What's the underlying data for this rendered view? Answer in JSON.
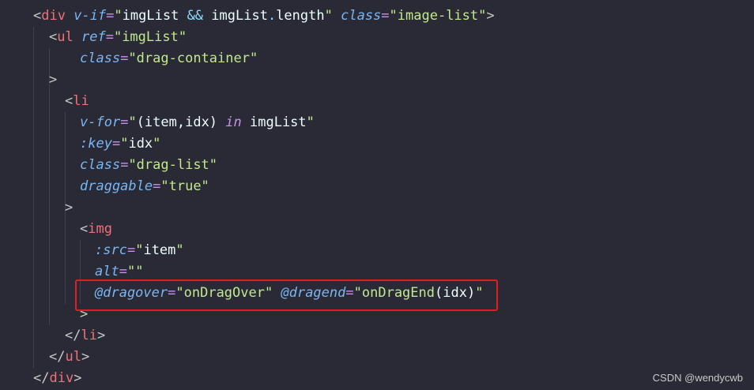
{
  "code_lines": [
    {
      "indent": 0,
      "tokens": [
        {
          "t": "<",
          "c": "punct"
        },
        {
          "t": "div",
          "c": "tag"
        },
        {
          "t": " ",
          "c": "plain"
        },
        {
          "t": "v-if",
          "c": "attr"
        },
        {
          "t": "=",
          "c": "eq"
        },
        {
          "t": "\"",
          "c": "str"
        },
        {
          "t": "imgList ",
          "c": "plain"
        },
        {
          "t": "&&",
          "c": "op"
        },
        {
          "t": " imgList",
          "c": "plain"
        },
        {
          "t": ".",
          "c": "op"
        },
        {
          "t": "length",
          "c": "plain"
        },
        {
          "t": "\"",
          "c": "str"
        },
        {
          "t": " ",
          "c": "plain"
        },
        {
          "t": "class",
          "c": "attr"
        },
        {
          "t": "=",
          "c": "eq"
        },
        {
          "t": "\"image-list\"",
          "c": "str"
        },
        {
          "t": ">",
          "c": "punct"
        }
      ]
    },
    {
      "indent": 1,
      "tokens": [
        {
          "t": "<",
          "c": "punct"
        },
        {
          "t": "ul",
          "c": "tag"
        },
        {
          "t": " ",
          "c": "plain"
        },
        {
          "t": "ref",
          "c": "attr"
        },
        {
          "t": "=",
          "c": "eq"
        },
        {
          "t": "\"imgList\"",
          "c": "str"
        }
      ]
    },
    {
      "indent": 3,
      "tokens": [
        {
          "t": "class",
          "c": "attr"
        },
        {
          "t": "=",
          "c": "eq"
        },
        {
          "t": "\"drag-container\"",
          "c": "str"
        }
      ]
    },
    {
      "indent": 1,
      "tokens": [
        {
          "t": ">",
          "c": "punct"
        }
      ]
    },
    {
      "indent": 2,
      "tokens": [
        {
          "t": "<",
          "c": "punct"
        },
        {
          "t": "li",
          "c": "tag"
        }
      ]
    },
    {
      "indent": 3,
      "tokens": [
        {
          "t": "v-for",
          "c": "attr"
        },
        {
          "t": "=",
          "c": "eq"
        },
        {
          "t": "\"",
          "c": "str"
        },
        {
          "t": "(item,idx) ",
          "c": "plain"
        },
        {
          "t": "in",
          "c": "kw"
        },
        {
          "t": " imgList",
          "c": "plain"
        },
        {
          "t": "\"",
          "c": "str"
        }
      ]
    },
    {
      "indent": 3,
      "tokens": [
        {
          "t": ":key",
          "c": "attr"
        },
        {
          "t": "=",
          "c": "eq"
        },
        {
          "t": "\"",
          "c": "str"
        },
        {
          "t": "idx",
          "c": "plain"
        },
        {
          "t": "\"",
          "c": "str"
        }
      ]
    },
    {
      "indent": 3,
      "tokens": [
        {
          "t": "class",
          "c": "attr"
        },
        {
          "t": "=",
          "c": "eq"
        },
        {
          "t": "\"drag-list\"",
          "c": "str"
        }
      ]
    },
    {
      "indent": 3,
      "tokens": [
        {
          "t": "draggable",
          "c": "attr"
        },
        {
          "t": "=",
          "c": "eq"
        },
        {
          "t": "\"true\"",
          "c": "str"
        }
      ]
    },
    {
      "indent": 2,
      "tokens": [
        {
          "t": ">",
          "c": "punct"
        }
      ]
    },
    {
      "indent": 3,
      "tokens": [
        {
          "t": "<",
          "c": "punct"
        },
        {
          "t": "img",
          "c": "tag"
        }
      ]
    },
    {
      "indent": 4,
      "tokens": [
        {
          "t": ":src",
          "c": "attr"
        },
        {
          "t": "=",
          "c": "eq"
        },
        {
          "t": "\"",
          "c": "str"
        },
        {
          "t": "item",
          "c": "plain"
        },
        {
          "t": "\"",
          "c": "str"
        }
      ]
    },
    {
      "indent": 4,
      "tokens": [
        {
          "t": "alt",
          "c": "attr"
        },
        {
          "t": "=",
          "c": "eq"
        },
        {
          "t": "\"\"",
          "c": "str"
        }
      ]
    },
    {
      "indent": 4,
      "tokens": [
        {
          "t": "@dragover",
          "c": "attr"
        },
        {
          "t": "=",
          "c": "eq"
        },
        {
          "t": "\"",
          "c": "str"
        },
        {
          "t": "onDragOver",
          "c": "str"
        },
        {
          "t": "\"",
          "c": "str"
        },
        {
          "t": " ",
          "c": "plain"
        },
        {
          "t": "@dragend",
          "c": "attr"
        },
        {
          "t": "=",
          "c": "eq"
        },
        {
          "t": "\"",
          "c": "str"
        },
        {
          "t": "onDragEnd",
          "c": "str"
        },
        {
          "t": "(idx)",
          "c": "plain"
        },
        {
          "t": "\"",
          "c": "str"
        }
      ]
    },
    {
      "indent": 3,
      "tokens": [
        {
          "t": ">",
          "c": "punct"
        }
      ]
    },
    {
      "indent": 2,
      "tokens": [
        {
          "t": "</",
          "c": "punct"
        },
        {
          "t": "li",
          "c": "tag"
        },
        {
          "t": ">",
          "c": "punct"
        }
      ]
    },
    {
      "indent": 1,
      "tokens": [
        {
          "t": "</",
          "c": "punct"
        },
        {
          "t": "ul",
          "c": "tag"
        },
        {
          "t": ">",
          "c": "punct"
        }
      ]
    },
    {
      "indent": 0,
      "tokens": [
        {
          "t": "</",
          "c": "punct"
        },
        {
          "t": "div",
          "c": "tag"
        },
        {
          "t": ">",
          "c": "punct"
        }
      ]
    }
  ],
  "highlighted_line": 13,
  "highlight_color": "#e02020",
  "watermark": "CSDN @wendycwb"
}
